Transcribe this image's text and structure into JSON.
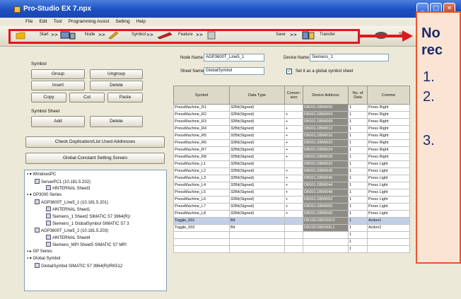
{
  "window": {
    "title": "Pro-Studio EX    7.npx",
    "buttons": [
      "_",
      "□",
      "×"
    ]
  },
  "menu": [
    "File",
    "Edit",
    "Tool",
    "Programming Assist",
    "Setting",
    "Help"
  ],
  "toolbar": {
    "start": "Start",
    "node": "Node",
    "symbol": "Symbol",
    "feature": "Feature",
    "save": "Save",
    "transfer": "Transfer",
    "double_arrow": ">>",
    "extra": "Sta"
  },
  "symbol_group": {
    "title": "Symbol",
    "group": "Group",
    "ungroup": "Ungroup",
    "insert": "Insert",
    "delete": "Delete",
    "copy": "Copy",
    "cut": "Cut",
    "paste": "Paste"
  },
  "sheet_group": {
    "title": "Symbol Sheet",
    "add": "Add",
    "delete": "Delete"
  },
  "check_button": "Check Duplication/List Used Addresses",
  "global_button": "Global Constant Setting Screen",
  "tree": [
    "WindowsPC",
    "ServerPC1 (10.181.5.202)",
    "#INTERNAL Sheet3",
    "GP3000 Series",
    "AGP3600T_Line5_1 (10.181.5.201)",
    "#INTERNAL Sheet1",
    "Siemens_1 Sheet2 SIMATIC S7 3964(R)/",
    "Siemens_1 GlobalSymbol SIMATIC S7 3",
    "AGP3600T_Line5_2 (10.181.5.203)",
    "#INTERNAL Sheet4",
    "Siemens_MPI Sheet5 SIMATIC S7 MPI",
    "GP Series",
    "Global Symbol",
    "GlobalSymbol SIMATIC S7 3964(R)/RK512"
  ],
  "form": {
    "node_name_label": "Node Name",
    "node_name": "AGP3600T_Line5_1",
    "device_name_label": "Device Name",
    "device_name": "Siemens_1",
    "sheet_name_label": "Sheet Name",
    "sheet_name": "GlobalSymbol",
    "global_check_label": "Set it as a global symbol sheet",
    "global_checked": true
  },
  "table": {
    "headers": [
      "Symbol",
      "Data Type",
      "Conver-sion",
      "Device Address",
      "No. of Data",
      "Comme"
    ],
    "rows": [
      [
        "PressMachine_R1",
        "32Bit(Signed)",
        "",
        "DB001.DBW000",
        "1",
        "Press Right"
      ],
      [
        "PressMachine_R2",
        "32Bit(Signed)",
        "+",
        "DB001.DBW004",
        "1",
        "Press Right"
      ],
      [
        "PressMachine_R3",
        "32Bit(Signed)",
        "+",
        "DB001.DBW008",
        "1",
        "Press Right"
      ],
      [
        "PressMachine_R4",
        "32Bit(Signed)",
        "+",
        "DB001.DBW012",
        "1",
        "Press Right"
      ],
      [
        "PressMachine_R5",
        "32Bit(Signed)",
        "+",
        "DB001.DBW016",
        "1",
        "Press Right"
      ],
      [
        "PressMachine_R6",
        "32Bit(Signed)",
        "+",
        "DB001.DBW020",
        "1",
        "Press Right"
      ],
      [
        "PressMachine_R7",
        "32Bit(Signed)",
        "+",
        "DB001.DBW024",
        "1",
        "Press Right"
      ],
      [
        "PressMachine_R8",
        "32Bit(Signed)",
        "+",
        "DB001.DBW028",
        "1",
        "Press Right"
      ],
      [
        "PressMachine_L1",
        "32Bit(Signed)",
        "",
        "DB001.DBW032",
        "1",
        "Press Light"
      ],
      [
        "PressMachine_L2",
        "32Bit(Signed)",
        "+",
        "DB001.DBW036",
        "1",
        "Press Light"
      ],
      [
        "PressMachine_L3",
        "32Bit(Signed)",
        "+",
        "DB001.DBW040",
        "1",
        "Press Light"
      ],
      [
        "PressMachine_L4",
        "32Bit(Signed)",
        "+",
        "DB001.DBW044",
        "1",
        "Press Light"
      ],
      [
        "PressMachine_L5",
        "32Bit(Signed)",
        "+",
        "DB001.DBW048",
        "1",
        "Press Light"
      ],
      [
        "PressMachine_L6",
        "32Bit(Signed)",
        "+",
        "DB001.DBW052",
        "1",
        "Press Light"
      ],
      [
        "PressMachine_L7",
        "32Bit(Signed)",
        "+",
        "DB001.DBW056",
        "1",
        "Press Light"
      ],
      [
        "PressMachine_L8",
        "32Bit(Signed)",
        "+",
        "DB001.DBW060",
        "1",
        "Press Light"
      ],
      [
        "Toggle_001",
        "Bit",
        "",
        "DB100.DBX000.0",
        "1",
        "Action1"
      ],
      [
        "Toggle_002",
        "Bit",
        "",
        "DB100.DBX000.1",
        "1",
        "Action2"
      ],
      [
        "",
        "",
        "",
        "",
        "1",
        ""
      ],
      [
        "",
        "",
        "",
        "",
        "1",
        ""
      ],
      [
        "",
        "",
        "",
        "",
        "1",
        ""
      ]
    ]
  },
  "note": {
    "title_line1": "No",
    "title_line2": "rec",
    "items": [
      "1.",
      "2.",
      "3."
    ]
  },
  "colors": {
    "highlight": "#e0171f",
    "note_bg": "#fbe4d3",
    "note_text": "#1a2a6b"
  }
}
